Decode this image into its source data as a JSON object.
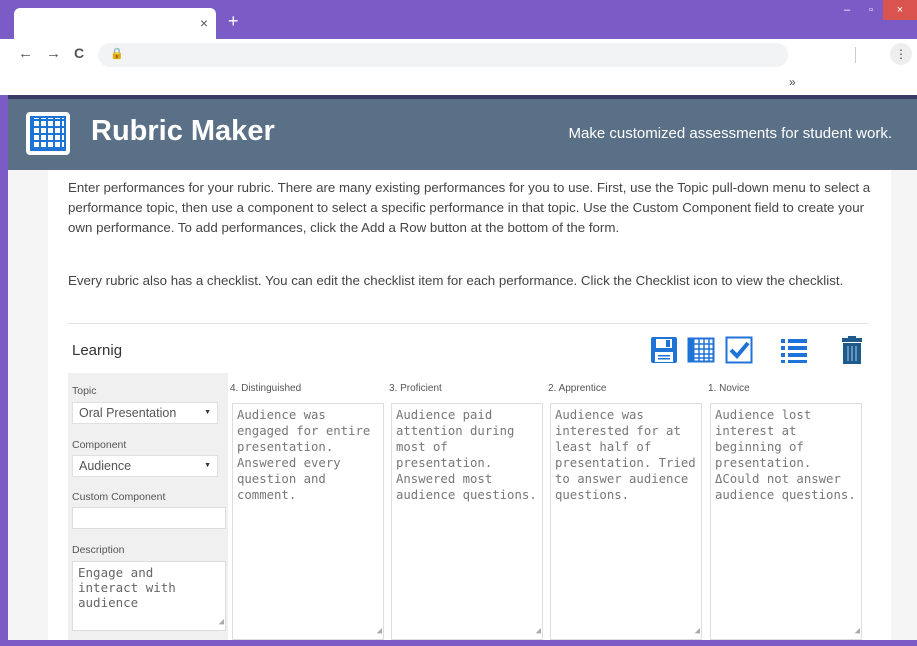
{
  "browser": {
    "tab_close": "×",
    "new_tab": "+",
    "back": "←",
    "forward": "→",
    "reload": "C",
    "lock": "🔒",
    "menu": "⋮",
    "bookmarks_overflow": "»",
    "window_min": "‒",
    "window_max": "▫",
    "window_close": "×"
  },
  "app": {
    "title": "Rubric Maker",
    "tagline": "Make customized assessments for student work."
  },
  "intro": {
    "paragraph1": "Enter performances for your rubric. There are many existing performances for you to use. First, use the Topic pull-down menu to select a performance topic, then use a component to select a specific performance in that topic. Use the Custom Component field to create your own performance. To add performances, click the Add a Row button at the bottom of the form.",
    "paragraph2": "Every rubric also has a checklist. You can edit the checklist item for each performance. Click the Checklist icon to view the checklist."
  },
  "rubric": {
    "name": "Learnig",
    "actions": [
      {
        "icon": "save-icon"
      },
      {
        "icon": "table-icon"
      },
      {
        "icon": "checklist-icon"
      },
      {
        "icon": "list-icon"
      },
      {
        "icon": "trash-icon"
      }
    ],
    "colors": {
      "accent": "#1e73d6",
      "header_bg": "#5a7087"
    }
  },
  "row": {
    "topic_label": "Topic",
    "topic_value": "Oral Presentation",
    "component_label": "Component",
    "component_value": "Audience",
    "custom_label": "Custom Component",
    "custom_value": "",
    "description_label": "Description",
    "description_value": "Engage and interact with audience",
    "levels": [
      {
        "heading": "4. Distinguished",
        "text": "Audience was engaged for entire presentation. Answered every question and comment."
      },
      {
        "heading": "3. Proficient",
        "text": "Audience paid attention during most of presentation. Answered most audience questions."
      },
      {
        "heading": "2. Apprentice",
        "text": "Audience was interested for at least half of presentation. Tried to answer audience questions."
      },
      {
        "heading": "1. Novice",
        "text": "Audience lost interest at beginning of presentation. ΔCould not answer audience questions."
      }
    ]
  }
}
